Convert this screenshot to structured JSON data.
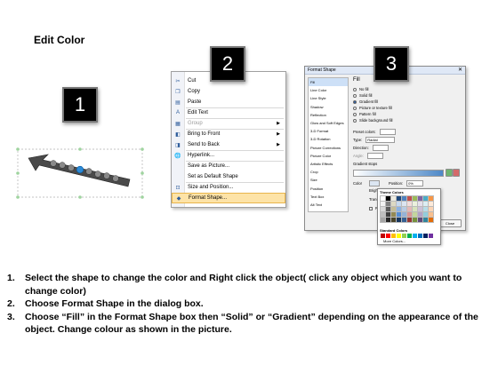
{
  "title": "Edit Color",
  "badges": [
    "1",
    "2",
    "3"
  ],
  "context_menu": {
    "items": [
      {
        "label": "Cut",
        "icon": "scissors-icon",
        "glyph": "✂",
        "submenu": false,
        "disabled": false
      },
      {
        "label": "Copy",
        "icon": "copy-icon",
        "glyph": "❐",
        "submenu": false,
        "disabled": false
      },
      {
        "label": "Paste",
        "icon": "paste-icon",
        "glyph": "▤",
        "submenu": false,
        "disabled": false
      },
      {
        "label": "Edit Text",
        "icon": "edit-text-icon",
        "glyph": "A",
        "submenu": false,
        "disabled": false
      },
      {
        "label": "Group",
        "icon": "group-icon",
        "glyph": "▦",
        "submenu": true,
        "disabled": true
      },
      {
        "label": "Bring to Front",
        "icon": "bring-front-icon",
        "glyph": "◧",
        "submenu": true,
        "disabled": false
      },
      {
        "label": "Send to Back",
        "icon": "send-back-icon",
        "glyph": "◨",
        "submenu": true,
        "disabled": false
      },
      {
        "label": "Hyperlink...",
        "icon": "hyperlink-icon",
        "glyph": "🌐",
        "submenu": false,
        "disabled": false
      },
      {
        "label": "Save as Picture...",
        "icon": "",
        "glyph": "",
        "submenu": false,
        "disabled": false
      },
      {
        "label": "Set as Default Shape",
        "icon": "",
        "glyph": "",
        "submenu": false,
        "disabled": false
      },
      {
        "label": "Size and Position...",
        "icon": "size-icon",
        "glyph": "⊡",
        "submenu": false,
        "disabled": false
      },
      {
        "label": "Format Shape...",
        "icon": "format-shape-icon",
        "glyph": "◆",
        "submenu": false,
        "disabled": false,
        "highlighted": true
      }
    ]
  },
  "dialog": {
    "title": "Format Shape",
    "close_glyph": "✕",
    "nav": [
      "Fill",
      "Line Color",
      "Line Style",
      "Shadow",
      "Reflection",
      "Glow and Soft Edges",
      "3-D Format",
      "3-D Rotation",
      "Picture Corrections",
      "Picture Color",
      "Artistic Effects",
      "Crop",
      "Size",
      "Position",
      "Text Box",
      "Alt Text"
    ],
    "pane_title": "Fill",
    "fill_options": [
      "No fill",
      "Solid fill",
      "Gradient fill",
      "Picture or texture fill",
      "Pattern fill",
      "Slide background fill"
    ],
    "selected_fill": "Gradient fill",
    "rows": {
      "preset": "Preset colors:",
      "type_label": "Type:",
      "type_value": "Radial",
      "direction": "Direction:",
      "angle": "Angle:",
      "stops": "Gradient stops"
    },
    "color_label": "Color",
    "position_label": "Position:",
    "position_value": "0%",
    "brightness_label": "Brightness",
    "transparency_label": "Transparen",
    "rotate_label": "Rotate w",
    "close_button": "Close"
  },
  "palette": {
    "theme_label": "Theme Colors",
    "standard_label": "Standard Colors",
    "more_label": "More Colors...",
    "theme_colors": [
      "#ffffff",
      "#000000",
      "#eeece1",
      "#1f497d",
      "#4f81bd",
      "#c0504d",
      "#9bbb59",
      "#8064a2",
      "#4bacc6",
      "#f79646",
      "#f2f2f2",
      "#7f7f7f",
      "#ddd9c3",
      "#c6d9f0",
      "#dbe5f1",
      "#f2dcdb",
      "#ebf1dd",
      "#e5e0ec",
      "#dbeef3",
      "#fdeada",
      "#d8d8d8",
      "#595959",
      "#c4bd97",
      "#8db3e2",
      "#b8cce4",
      "#e5b9b7",
      "#d7e3bc",
      "#ccc1d9",
      "#b7dde8",
      "#fbd5b5",
      "#bfbfbf",
      "#3f3f3f",
      "#938953",
      "#548dd4",
      "#95b3d7",
      "#d99694",
      "#c3d69b",
      "#b2a2c7",
      "#92cddc",
      "#fac08f",
      "#a5a5a5",
      "#262626",
      "#494429",
      "#17365d",
      "#366092",
      "#953734",
      "#76923c",
      "#5f497a",
      "#31859b",
      "#e36c09"
    ],
    "standard_colors": [
      "#c00000",
      "#ff0000",
      "#ffc000",
      "#ffff00",
      "#92d050",
      "#00b050",
      "#00b0f0",
      "#0070c0",
      "#002060",
      "#7030a0"
    ]
  },
  "steps": [
    {
      "num": "1.",
      "text": "Select the shape to change the color and Right click the object( click any object which you want to change color)"
    },
    {
      "num": "2.",
      "text": "Choose Format Shape in the dialog box."
    },
    {
      "num": "3.",
      "text": "Choose “Fill” in the Format Shape box then “Solid” or “Gradient” depending on the appearance of the object. Change colour as shown in the picture."
    }
  ]
}
